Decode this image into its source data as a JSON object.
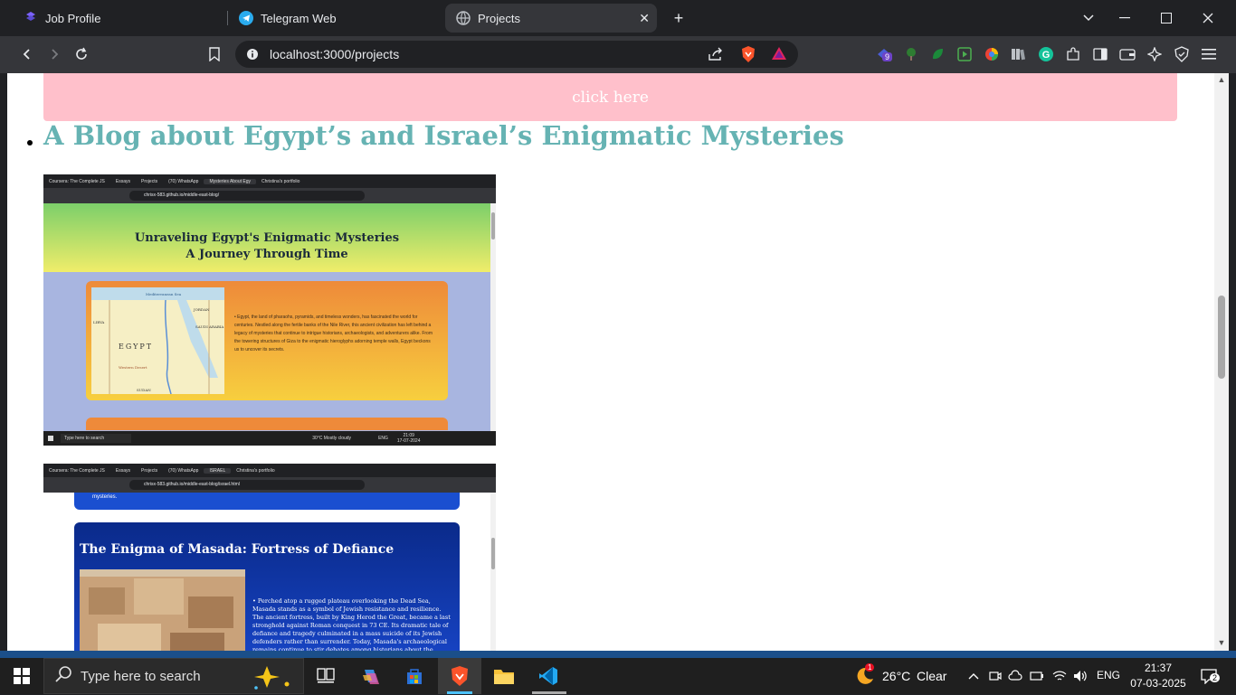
{
  "browser": {
    "tabs": [
      {
        "label": "Job Profile",
        "icon": "app-icon"
      },
      {
        "label": "Telegram Web",
        "icon": "telegram-icon"
      },
      {
        "label": "Projects",
        "icon": "globe-icon",
        "active": true
      }
    ],
    "url": "localhost:3000/projects",
    "extension_badge": "9"
  },
  "page": {
    "click_button": "click here",
    "blog_title": "A Blog about Egypt’s and Israel’s Enigmatic Mysteries"
  },
  "screenshot1": {
    "tabs": [
      "Coursera: The Complete JS",
      "Essays",
      "Projects",
      "(70) WhatsApp",
      "Mysteries About Egy",
      "Christina's portfolio"
    ],
    "url": "chrisx-583.github.io/middle-east-blog/",
    "header_line1": "Unraveling Egypt's Enigmatic Mysteries",
    "header_line2": "A Journey Through Time",
    "map_country": "EGYPT",
    "map_labels": [
      "Mediterranean Sea",
      "LIBYA",
      "SAUDI ARABIA",
      "JORDAN",
      "SUDAN",
      "Western Desert"
    ],
    "text": "Egypt, the land of pharaohs, pyramids, and timeless wonders, has fascinated the world for centuries. Nestled along the fertile banks of the Nile River, this ancient civilization has left behind a legacy of mysteries that continue to intrigue historians, archaeologists, and adventurers alike. From the towering structures of Giza to the enigmatic hieroglyphs adorning temple walls, Egypt beckons us to uncover its secrets.",
    "taskbar_search": "Type here to search",
    "weather": "30°C  Mostly cloudy",
    "lang": "ENG",
    "time": "21:09",
    "date": "17-07-2024"
  },
  "screenshot2": {
    "tabs": [
      "Coursera: The Complete JS",
      "Essays",
      "Projects",
      "(70) WhatsApp",
      "ISRAEL",
      "Christina's portfolio"
    ],
    "url": "chrisx-583.github.io/middle-east-blog/israel.html",
    "top_fragment": "mysteries.",
    "card_title": "The Enigma of Masada: Fortress of Defiance",
    "text": "Perched atop a rugged plateau overlooking the Dead Sea, Masada stands as a symbol of Jewish resistance and resilience. The ancient fortress, built by King Herod the Great, became a last stronghold against Roman conquest in 73 CE. Its dramatic tale of defiance and tragedy culminated in a mass suicide of its Jewish defenders rather than surrender. Today, Masada's archaeological remains continue to stir debates among historians about the events that unfolded within its formidable walls and"
  },
  "taskbar": {
    "search_placeholder": "Type here to search",
    "temperature": "26°C",
    "weather": "Clear",
    "language": "ENG",
    "time": "21:37",
    "date": "07-03-2025",
    "notification_count": "2",
    "weather_badge": "1"
  },
  "colors": {
    "click_button_bg": "#ffc0cb",
    "blog_title": "#66b3b3",
    "taskbar_bg": "#1f1f1f"
  }
}
